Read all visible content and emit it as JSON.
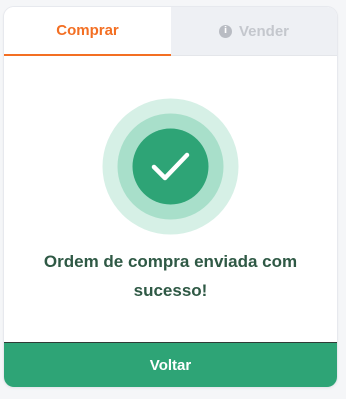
{
  "tabs": {
    "buy_label": "Comprar",
    "sell_label": "Vender",
    "sell_icon_glyph": "i"
  },
  "status": {
    "message_line1": "Ordem de compra enviada com",
    "message_line2": "sucesso!"
  },
  "actions": {
    "back_label": "Voltar"
  },
  "colors": {
    "accent_orange": "#f36f23",
    "success_green": "#2ea476",
    "message_text": "#2f5945",
    "tab_inactive_bg": "#eef0f4",
    "tab_inactive_text": "#c4c7cd"
  },
  "icons": {
    "success": "check-icon",
    "sell_tab": "info-icon"
  }
}
